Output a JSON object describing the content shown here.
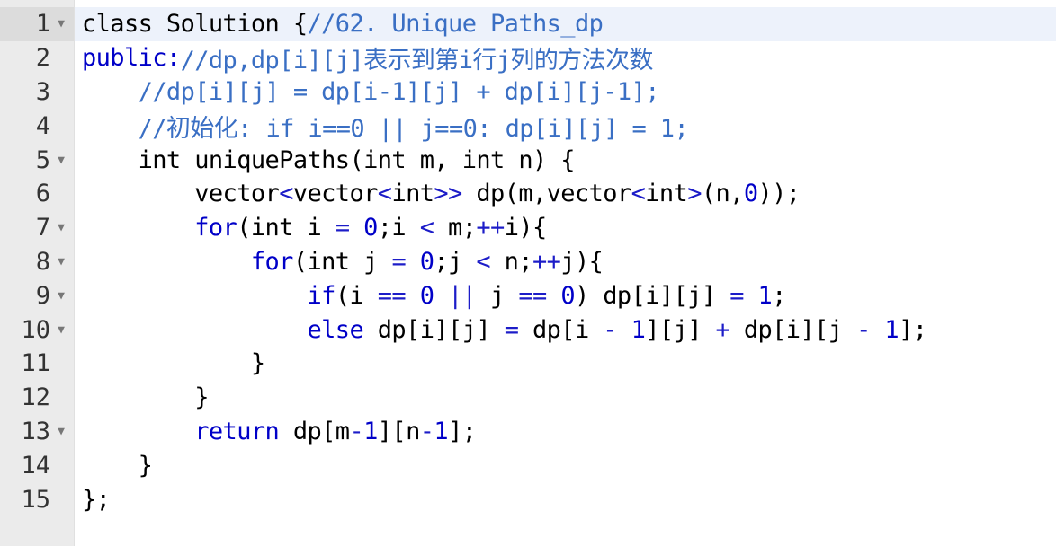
{
  "lines": [
    {
      "num": "1",
      "fold": true
    },
    {
      "num": "2",
      "fold": false
    },
    {
      "num": "3",
      "fold": false
    },
    {
      "num": "4",
      "fold": false
    },
    {
      "num": "5",
      "fold": true
    },
    {
      "num": "6",
      "fold": false
    },
    {
      "num": "7",
      "fold": true
    },
    {
      "num": "8",
      "fold": true
    },
    {
      "num": "9",
      "fold": true
    },
    {
      "num": "10",
      "fold": true
    },
    {
      "num": "11",
      "fold": false
    },
    {
      "num": "12",
      "fold": false
    },
    {
      "num": "13",
      "fold": true
    },
    {
      "num": "14",
      "fold": false
    },
    {
      "num": "15",
      "fold": false
    }
  ],
  "tokens": {
    "l1": [
      "class Solution {",
      "//62. Unique Paths_dp"
    ],
    "l2": [
      "public:",
      "//dp,dp[i][j]表示到第i行j列的方法次数"
    ],
    "l3": [
      "    ",
      "//dp[i][j] = dp[i-1][j] + dp[i][j-1];"
    ],
    "l4": [
      "    ",
      "//初始化: if i==0 || j==0: dp[i][j] = 1;"
    ],
    "l5": [
      "    int uniquePaths(int m, int n) {"
    ],
    "l6": [
      "        vector",
      "<",
      "vector",
      "<",
      "int",
      ">>",
      " dp(m,vector",
      "<",
      "int",
      ">",
      "(n,",
      "0",
      "));"
    ],
    "l7": [
      "        ",
      "for",
      "(int i ",
      "=",
      " ",
      "0",
      ";i ",
      "<",
      " m;",
      "++",
      "i){"
    ],
    "l8": [
      "            ",
      "for",
      "(int j ",
      "=",
      " ",
      "0",
      ";j ",
      "<",
      " n;",
      "++",
      "j){"
    ],
    "l9": [
      "                ",
      "if",
      "(i ",
      "==",
      " ",
      "0",
      " ",
      "||",
      " j ",
      "==",
      " ",
      "0",
      ") dp[i][j] ",
      "=",
      " ",
      "1",
      ";"
    ],
    "l10": [
      "                ",
      "else",
      " dp[i][j] ",
      "=",
      " dp[i ",
      "-",
      " ",
      "1",
      "][j] ",
      "+",
      " dp[i][j ",
      "-",
      " ",
      "1",
      "];"
    ],
    "l11": [
      "            }"
    ],
    "l12": [
      "        }"
    ],
    "l13": [
      "        ",
      "return",
      " dp[m",
      "-",
      "1",
      "][n",
      "-",
      "1",
      "];"
    ],
    "l14": [
      "    }"
    ],
    "l15": [
      "};"
    ]
  },
  "fold_icon": "triangle-down-icon"
}
